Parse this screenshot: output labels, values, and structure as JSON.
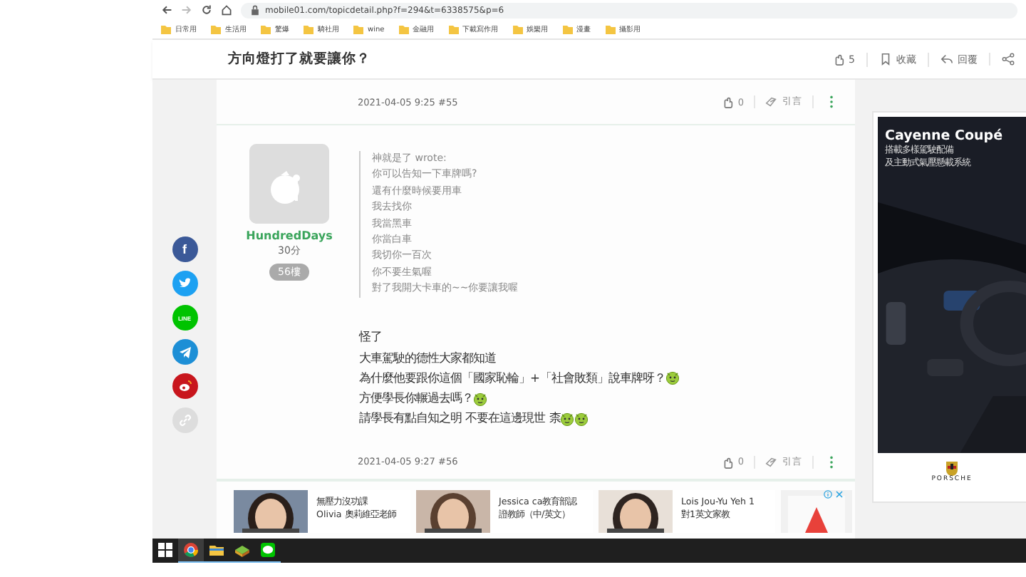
{
  "browser": {
    "url": "mobile01.com/topicdetail.php?f=294&t=6338575&p=6",
    "bookmarks": [
      "日常用",
      "生活用",
      "驚爆",
      "騎社用",
      "wine",
      "金融用",
      "下載寫作用",
      "娛樂用",
      "漫畫",
      "攝影用"
    ]
  },
  "header": {
    "title": "方向燈打了就要讓你？",
    "actions": [
      {
        "kind": "like",
        "label": "5"
      },
      {
        "kind": "bookmark",
        "label": "收藏"
      },
      {
        "kind": "reply",
        "label": "回覆"
      },
      {
        "kind": "share"
      }
    ]
  },
  "share_buttons": [
    {
      "kind": "facebook",
      "color": "#3b5998",
      "label": "f"
    },
    {
      "kind": "twitter",
      "color": "#1da1f2"
    },
    {
      "kind": "line",
      "color": "#00c300",
      "label": "LINE"
    },
    {
      "kind": "telegram",
      "color": "#1d8fd6"
    },
    {
      "kind": "weibo",
      "color": "#c8161d"
    },
    {
      "kind": "link",
      "color": "#dddddd"
    }
  ],
  "previous_post_footer": {
    "meta": "2021-04-05 9:25 #55",
    "likes": "0",
    "quote": "引言"
  },
  "post": {
    "author": "HundredDays",
    "score": "30分",
    "floor": "56樓",
    "quote": {
      "header": "神就是了 wrote:",
      "lines": [
        "你可以告知一下車牌嗎?",
        "還有什麼時候要用車",
        "我去找你",
        "我當黑車",
        "你當白車",
        "我切你一百次",
        "你不要生氣喔",
        "對了我開大卡車的~~你要讓我喔"
      ]
    },
    "body": [
      {
        "text": "怪了"
      },
      {
        "text": "大車駕駛的德性大家都知道"
      },
      {
        "text": "為什麼他要跟你這個「國家恥輪」+「社會敗類」說車牌呀？",
        "emojis": [
          {
            "kind": "devil"
          }
        ]
      },
      {
        "text": "方便學長你輾過去嗎？",
        "emojis": [
          {
            "kind": "devil"
          }
        ]
      },
      {
        "text": "請學長有點自知之明 不要在這邊現世 柰",
        "emojis": [
          {
            "kind": "devil"
          },
          {
            "kind": "devil"
          }
        ]
      }
    ],
    "footer": {
      "meta": "2021-04-05 9:27 #56",
      "likes": "0",
      "quote": "引言"
    }
  },
  "ad_strip": {
    "cards": [
      {
        "lines": [
          "無壓力沒功課",
          "Olivia 奧莉維亞老師"
        ]
      },
      {
        "lines": [
          "Jessica ca教育部認",
          "證教師（中/英文）"
        ]
      },
      {
        "lines": [
          "Lois Jou-Yu Yeh 1",
          "對1英文家教"
        ]
      }
    ]
  },
  "side_ad": {
    "headline": "Cayenne Coupé",
    "lines": [
      "搭載多樣駕駛配備",
      "及主動式氣壓懸載系統"
    ],
    "brand": "PORSCHE"
  },
  "taskbar": {
    "apps": [
      {
        "kind": "start",
        "selected": false
      },
      {
        "kind": "chrome",
        "selected": true
      },
      {
        "kind": "folder",
        "selected": false
      },
      {
        "kind": "game",
        "selected": false
      },
      {
        "kind": "line",
        "selected": false
      }
    ]
  }
}
